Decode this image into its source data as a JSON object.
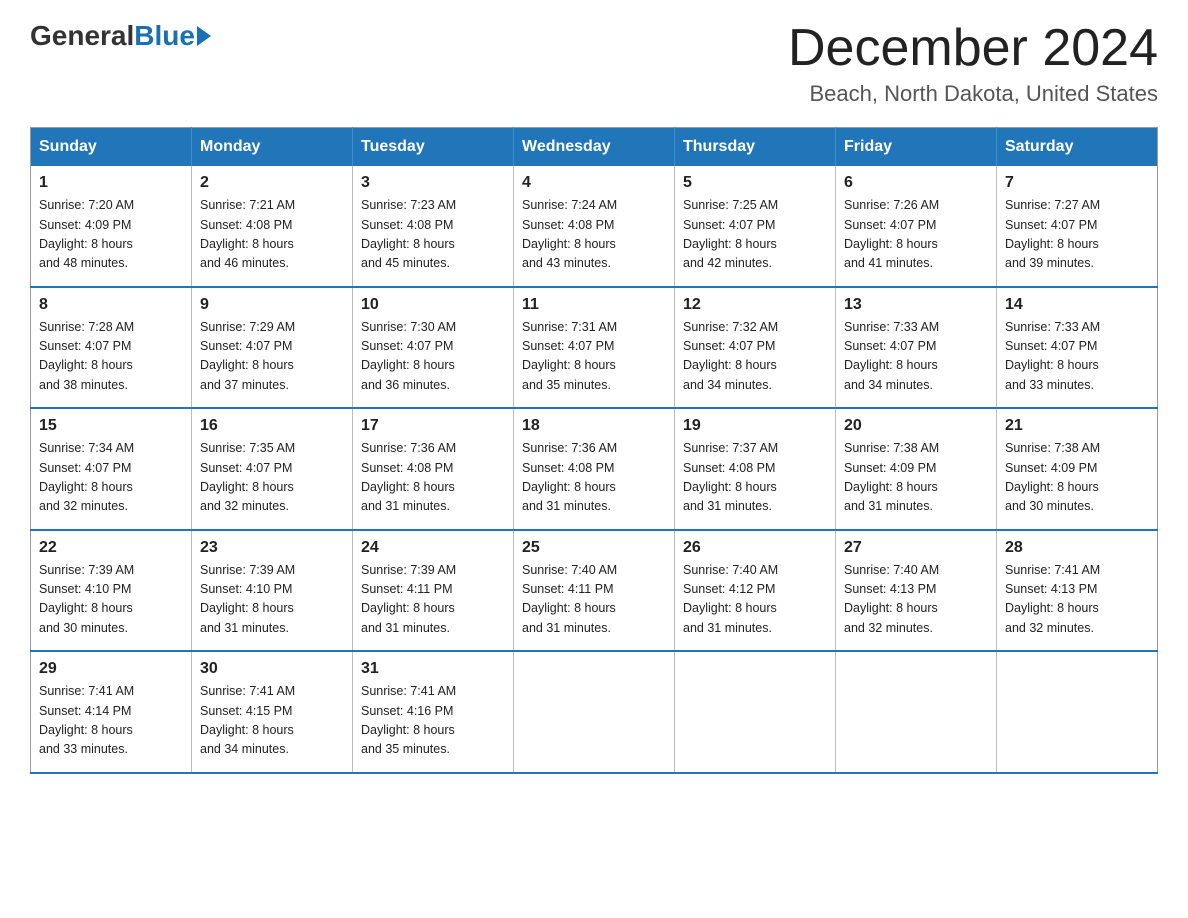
{
  "logo": {
    "general": "General",
    "blue": "Blue"
  },
  "title": "December 2024",
  "location": "Beach, North Dakota, United States",
  "days_of_week": [
    "Sunday",
    "Monday",
    "Tuesday",
    "Wednesday",
    "Thursday",
    "Friday",
    "Saturday"
  ],
  "weeks": [
    [
      {
        "day": "1",
        "sunrise": "7:20 AM",
        "sunset": "4:09 PM",
        "daylight": "8 hours and 48 minutes."
      },
      {
        "day": "2",
        "sunrise": "7:21 AM",
        "sunset": "4:08 PM",
        "daylight": "8 hours and 46 minutes."
      },
      {
        "day": "3",
        "sunrise": "7:23 AM",
        "sunset": "4:08 PM",
        "daylight": "8 hours and 45 minutes."
      },
      {
        "day": "4",
        "sunrise": "7:24 AM",
        "sunset": "4:08 PM",
        "daylight": "8 hours and 43 minutes."
      },
      {
        "day": "5",
        "sunrise": "7:25 AM",
        "sunset": "4:07 PM",
        "daylight": "8 hours and 42 minutes."
      },
      {
        "day": "6",
        "sunrise": "7:26 AM",
        "sunset": "4:07 PM",
        "daylight": "8 hours and 41 minutes."
      },
      {
        "day": "7",
        "sunrise": "7:27 AM",
        "sunset": "4:07 PM",
        "daylight": "8 hours and 39 minutes."
      }
    ],
    [
      {
        "day": "8",
        "sunrise": "7:28 AM",
        "sunset": "4:07 PM",
        "daylight": "8 hours and 38 minutes."
      },
      {
        "day": "9",
        "sunrise": "7:29 AM",
        "sunset": "4:07 PM",
        "daylight": "8 hours and 37 minutes."
      },
      {
        "day": "10",
        "sunrise": "7:30 AM",
        "sunset": "4:07 PM",
        "daylight": "8 hours and 36 minutes."
      },
      {
        "day": "11",
        "sunrise": "7:31 AM",
        "sunset": "4:07 PM",
        "daylight": "8 hours and 35 minutes."
      },
      {
        "day": "12",
        "sunrise": "7:32 AM",
        "sunset": "4:07 PM",
        "daylight": "8 hours and 34 minutes."
      },
      {
        "day": "13",
        "sunrise": "7:33 AM",
        "sunset": "4:07 PM",
        "daylight": "8 hours and 34 minutes."
      },
      {
        "day": "14",
        "sunrise": "7:33 AM",
        "sunset": "4:07 PM",
        "daylight": "8 hours and 33 minutes."
      }
    ],
    [
      {
        "day": "15",
        "sunrise": "7:34 AM",
        "sunset": "4:07 PM",
        "daylight": "8 hours and 32 minutes."
      },
      {
        "day": "16",
        "sunrise": "7:35 AM",
        "sunset": "4:07 PM",
        "daylight": "8 hours and 32 minutes."
      },
      {
        "day": "17",
        "sunrise": "7:36 AM",
        "sunset": "4:08 PM",
        "daylight": "8 hours and 31 minutes."
      },
      {
        "day": "18",
        "sunrise": "7:36 AM",
        "sunset": "4:08 PM",
        "daylight": "8 hours and 31 minutes."
      },
      {
        "day": "19",
        "sunrise": "7:37 AM",
        "sunset": "4:08 PM",
        "daylight": "8 hours and 31 minutes."
      },
      {
        "day": "20",
        "sunrise": "7:38 AM",
        "sunset": "4:09 PM",
        "daylight": "8 hours and 31 minutes."
      },
      {
        "day": "21",
        "sunrise": "7:38 AM",
        "sunset": "4:09 PM",
        "daylight": "8 hours and 30 minutes."
      }
    ],
    [
      {
        "day": "22",
        "sunrise": "7:39 AM",
        "sunset": "4:10 PM",
        "daylight": "8 hours and 30 minutes."
      },
      {
        "day": "23",
        "sunrise": "7:39 AM",
        "sunset": "4:10 PM",
        "daylight": "8 hours and 31 minutes."
      },
      {
        "day": "24",
        "sunrise": "7:39 AM",
        "sunset": "4:11 PM",
        "daylight": "8 hours and 31 minutes."
      },
      {
        "day": "25",
        "sunrise": "7:40 AM",
        "sunset": "4:11 PM",
        "daylight": "8 hours and 31 minutes."
      },
      {
        "day": "26",
        "sunrise": "7:40 AM",
        "sunset": "4:12 PM",
        "daylight": "8 hours and 31 minutes."
      },
      {
        "day": "27",
        "sunrise": "7:40 AM",
        "sunset": "4:13 PM",
        "daylight": "8 hours and 32 minutes."
      },
      {
        "day": "28",
        "sunrise": "7:41 AM",
        "sunset": "4:13 PM",
        "daylight": "8 hours and 32 minutes."
      }
    ],
    [
      {
        "day": "29",
        "sunrise": "7:41 AM",
        "sunset": "4:14 PM",
        "daylight": "8 hours and 33 minutes."
      },
      {
        "day": "30",
        "sunrise": "7:41 AM",
        "sunset": "4:15 PM",
        "daylight": "8 hours and 34 minutes."
      },
      {
        "day": "31",
        "sunrise": "7:41 AM",
        "sunset": "4:16 PM",
        "daylight": "8 hours and 35 minutes."
      },
      null,
      null,
      null,
      null
    ]
  ],
  "labels": {
    "sunrise": "Sunrise:",
    "sunset": "Sunset:",
    "daylight": "Daylight:"
  }
}
